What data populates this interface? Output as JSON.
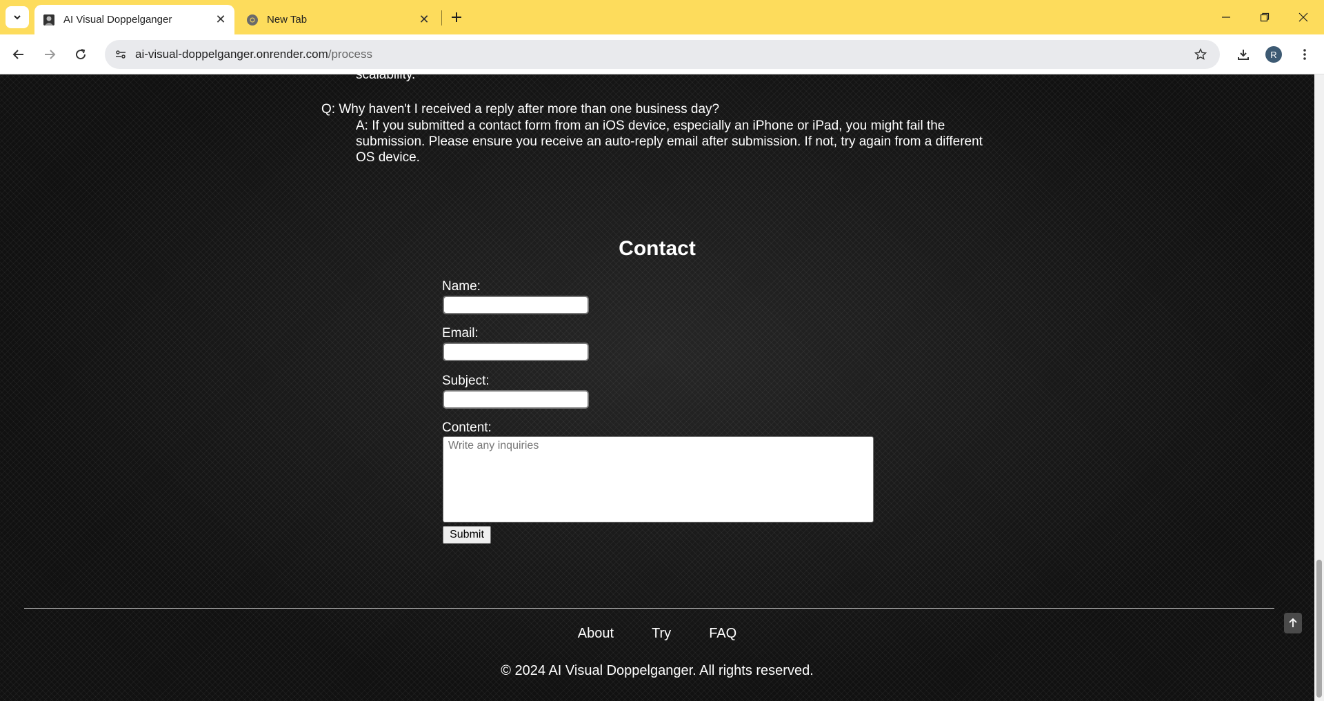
{
  "browser": {
    "tabs": [
      {
        "title": "AI Visual Doppelganger",
        "active": true
      },
      {
        "title": "New Tab",
        "active": false
      }
    ],
    "url_host": "ai-visual-doppelganger.onrender.com",
    "url_path": "/process",
    "profile_initial": "R",
    "accent_color": "#fddc5c"
  },
  "faq": {
    "previous_answer_tail": "scalability.",
    "question": "Q: Why haven't I received a reply after more than one business day?",
    "answer": "A: If you submitted a contact form from an iOS device, especially an iPhone or iPad, you might fail the submission. Please ensure you receive an auto-reply email after submission. If not, try again from a different OS device."
  },
  "contact": {
    "title": "Contact",
    "name_label": "Name:",
    "email_label": "Email:",
    "subject_label": "Subject:",
    "content_label": "Content:",
    "content_placeholder": "Write any inquiries",
    "submit_label": "Submit"
  },
  "footer": {
    "links": [
      "About",
      "Try",
      "FAQ"
    ],
    "copyright": "© 2024 AI Visual Doppelganger. All rights reserved."
  }
}
